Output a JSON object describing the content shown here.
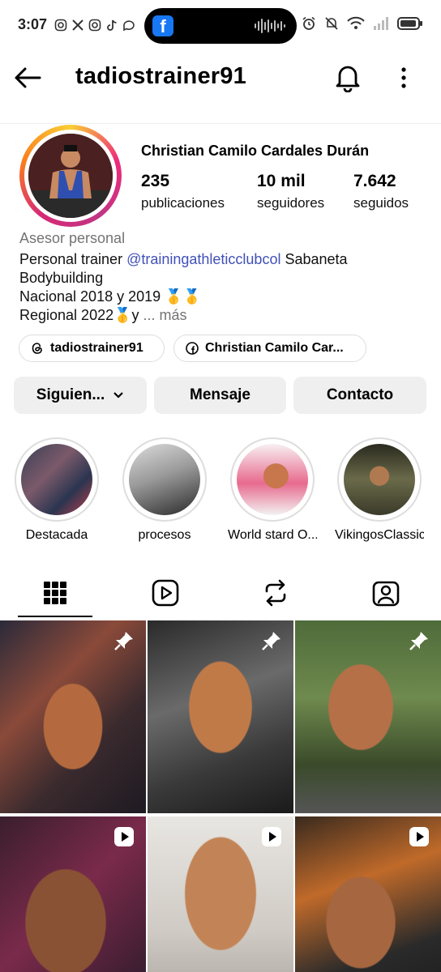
{
  "status_bar": {
    "time": "3:07",
    "left_icons": [
      "instagram-icon",
      "x-icon",
      "instagram-icon",
      "tiktok-icon",
      "chat-icon"
    ],
    "right_icons": [
      "alarm-icon",
      "mute-icon",
      "wifi-icon",
      "signal-icon",
      "battery-icon"
    ]
  },
  "header": {
    "username": "tadiostrainer91"
  },
  "profile": {
    "full_name": "Christian Camilo Cardales Durán",
    "stats": [
      {
        "value": "235",
        "label": "publicaciones"
      },
      {
        "value": "10 mil",
        "label": "seguidores"
      },
      {
        "value": "7.642",
        "label": "seguidos"
      }
    ],
    "category": "Asesor personal",
    "bio": {
      "line1_prefix": "Personal trainer ",
      "line1_mention": "@trainingathleticclubcol",
      "line1_suffix": " Sabaneta",
      "line2": "Bodybuilding",
      "line3": "Nacional 2018 y 2019 🥇🥇",
      "line4": "Regional 2022🥇y",
      "more": " ... más"
    },
    "links": [
      {
        "label": "tadiostrainer91",
        "icon": "threads-icon"
      },
      {
        "label": "Christian Camilo Car...",
        "icon": "facebook-icon"
      }
    ],
    "actions": {
      "following": "Siguien...",
      "message": "Mensaje",
      "contact": "Contacto"
    }
  },
  "highlights": [
    {
      "label": "Destacada"
    },
    {
      "label": "procesos"
    },
    {
      "label": "World stard O..."
    },
    {
      "label": "VikingosClassic"
    }
  ],
  "tabs": [
    "grid-icon",
    "reels-icon",
    "reposts-icon",
    "tagged-icon"
  ],
  "posts": [
    {
      "badge": "pin-icon"
    },
    {
      "badge": "pin-icon"
    },
    {
      "badge": "pin-icon"
    },
    {
      "badge": "reel-icon"
    },
    {
      "badge": "reel-icon"
    },
    {
      "badge": "reel-icon"
    }
  ]
}
